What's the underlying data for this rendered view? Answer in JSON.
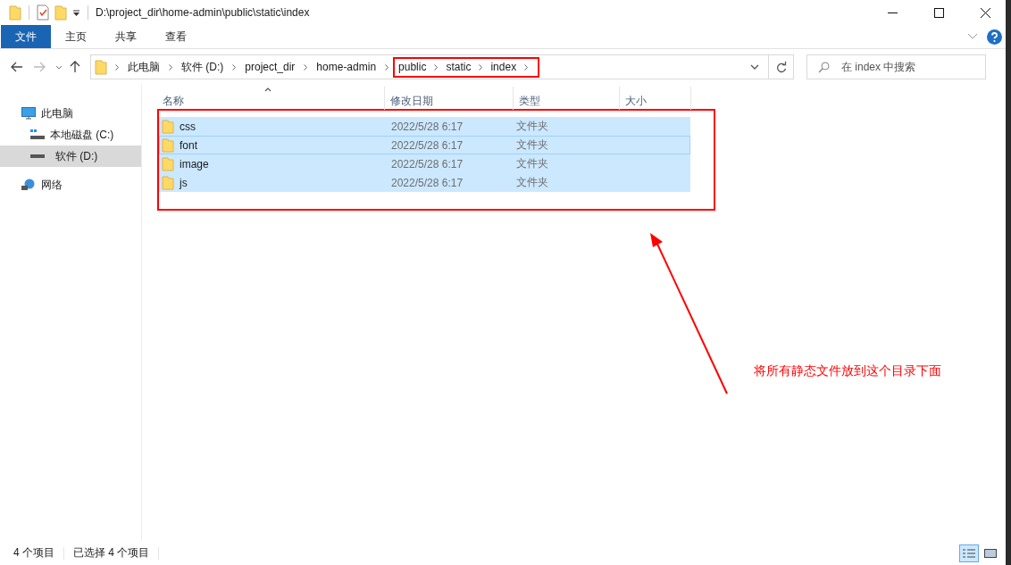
{
  "window": {
    "title": "D:\\project_dir\\home-admin\\public\\static\\index"
  },
  "ribbon_tabs": [
    {
      "label": "文件",
      "selected": true
    },
    {
      "label": "主页",
      "selected": false
    },
    {
      "label": "共享",
      "selected": false
    },
    {
      "label": "查看",
      "selected": false
    }
  ],
  "breadcrumb": [
    {
      "label": "此电脑",
      "highlighted": false
    },
    {
      "label": "软件 (D:)",
      "highlighted": false
    },
    {
      "label": "project_dir",
      "highlighted": false
    },
    {
      "label": "home-admin",
      "highlighted": false
    },
    {
      "label": "public",
      "highlighted": true
    },
    {
      "label": "static",
      "highlighted": true
    },
    {
      "label": "index",
      "highlighted": true
    }
  ],
  "search": {
    "placeholder": "在 index 中搜索"
  },
  "sidebar": {
    "items": [
      {
        "label": "此电脑",
        "kind": "computer",
        "selected": false,
        "children": [
          {
            "label": "本地磁盘 (C:)",
            "kind": "system-drive",
            "selected": false
          },
          {
            "label": "软件 (D:)",
            "kind": "drive",
            "selected": true
          }
        ]
      },
      {
        "label": "网络",
        "kind": "network",
        "selected": false
      }
    ]
  },
  "table": {
    "highlighted": true,
    "columns": [
      {
        "label": "名称",
        "sorted": true
      },
      {
        "label": "修改日期",
        "sorted": false
      },
      {
        "label": "类型",
        "sorted": false
      },
      {
        "label": "大小",
        "sorted": false
      }
    ],
    "rows": [
      {
        "name": "css",
        "modified": "2022/5/28 6:17",
        "type": "文件夹",
        "selected": true,
        "focused": false
      },
      {
        "name": "font",
        "modified": "2022/5/28 6:17",
        "type": "文件夹",
        "selected": true,
        "focused": true
      },
      {
        "name": "image",
        "modified": "2022/5/28 6:17",
        "type": "文件夹",
        "selected": true,
        "focused": false
      },
      {
        "name": "js",
        "modified": "2022/5/28 6:17",
        "type": "文件夹",
        "selected": true,
        "focused": false
      }
    ]
  },
  "annotation": {
    "text": "将所有静态文件放到这个目录下面"
  },
  "status_bar": {
    "item_count": "4 个项目",
    "selection": "已选择 4 个项目",
    "views": [
      {
        "kind": "details",
        "selected": true
      },
      {
        "kind": "large-icons",
        "selected": false
      }
    ]
  }
}
